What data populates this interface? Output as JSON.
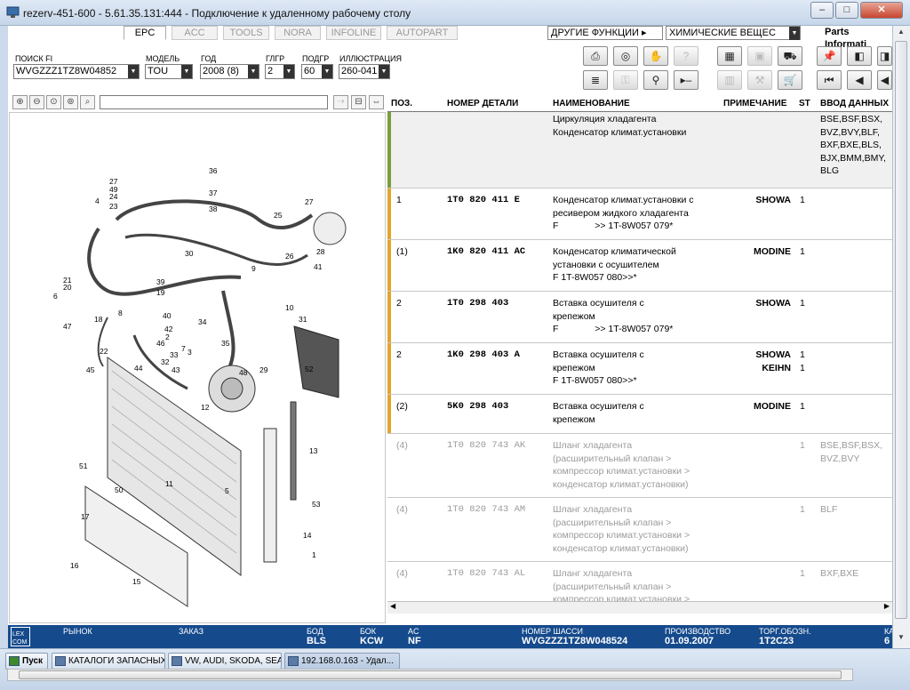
{
  "window": {
    "title": "rezerv-451-600 - 5.61.35.131:444 - Подключение к удаленному рабочему столу"
  },
  "tabs": [
    {
      "label": "EPC",
      "active": true
    },
    {
      "label": "ACC"
    },
    {
      "label": "TOOLS"
    },
    {
      "label": "NORA"
    },
    {
      "label": "INFOLINE"
    },
    {
      "label": "AUTOPART"
    }
  ],
  "top_menus": {
    "other_functions": "ДРУГИЕ ФУНКЦИИ",
    "chemicals": "ХИМИЧЕСКИЕ ВЕЩЕС",
    "parts_info": "Parts Informati"
  },
  "filters": {
    "vin": {
      "label": "ПОИСК FI",
      "value": "WVGZZZ1TZ8W04852"
    },
    "model": {
      "label": "МОДЕЛЬ",
      "value": "TOU"
    },
    "year": {
      "label": "ГОД",
      "value": "2008 (8)"
    },
    "group": {
      "label": "ГЛГР",
      "value": "2"
    },
    "subgroup": {
      "label": "ПОДГР",
      "value": "60"
    },
    "illustration": {
      "label": "ИЛЛЮСТРАЦИЯ",
      "value": "260-041"
    }
  },
  "table": {
    "headers": {
      "pos": "ПОЗ.",
      "part_no": "НОМЕР ДЕТАЛИ",
      "name": "НАИМЕНОВАНИЕ",
      "note": "ПРИМЕЧАНИЕ",
      "qty": "ST",
      "input": "ВВОД ДАННЫХ"
    },
    "header_row": {
      "name": "Циркуляция хладагента\nКонденсатор климат.установки",
      "input": "BSE,BSF,BSX,\nBVZ,BVY,BLF,\nBXF,BXE,BLS,\nBJX,BMM,BMY,\nBLG"
    },
    "rows": [
      {
        "pos": "1",
        "part": "1T0 820 411 E",
        "name": "Конденсатор климат.установки с\nресивером жидкого хладагента\nF              >> 1T-8W057 079*",
        "note": "SHOWA",
        "qty": "1",
        "input": ""
      },
      {
        "pos": "(1)",
        "part": "1K0 820 411 AC",
        "name": "Конденсатор климатической\nустановки с осушителем\nF 1T-8W057 080>>*",
        "note": "MODINE",
        "qty": "1",
        "input": ""
      },
      {
        "pos": "2",
        "part": "1T0 298 403",
        "name": "Вставка осушителя с\nкрепежом\nF              >> 1T-8W057 079*",
        "note": "SHOWA",
        "qty": "1",
        "input": ""
      },
      {
        "pos": "2",
        "part": "1K0 298 403 A",
        "name": "Вставка осушителя с\nкрепежом\nF 1T-8W057 080>>*",
        "note": "SHOWA\nKEIHN",
        "qty": "1\n1",
        "input": ""
      },
      {
        "pos": "(2)",
        "part": "5K0 298 403",
        "name": "Вставка осушителя с\nкрепежом",
        "note": "MODINE",
        "qty": "1",
        "input": ""
      },
      {
        "pos": "(4)",
        "part": "1T0 820 743 AK",
        "name": "Шланг хладагента\n(расширительный клапан >\nкомпрессор климат.установки >\nконденсатор климат.установки)",
        "note": "",
        "qty": "1",
        "input": "BSE,BSF,BSX,\nBVZ,BVY"
      },
      {
        "pos": "(4)",
        "part": "1T0 820 743 AM",
        "name": "Шланг хладагента\n(расширительный клапан >\nкомпрессор климат.установки >\nконденсатор климат.установки)",
        "note": "",
        "qty": "1",
        "input": "BLF"
      },
      {
        "pos": "(4)",
        "part": "1T0 820 743 AL",
        "name": "Шланг хладагента\n(расширительный клапан >\nкомпрессор климат.установки >",
        "note": "",
        "qty": "1",
        "input": "BXF,BXE"
      }
    ]
  },
  "status": {
    "market": {
      "label": "РЫНОК",
      "value": ""
    },
    "order": {
      "label": "ЗАКАЗ",
      "value": ""
    },
    "bod": {
      "label": "БОД",
      "value": "BLS"
    },
    "bok": {
      "label": "БОК",
      "value": "KCW"
    },
    "ac": {
      "label": "AC",
      "value": "NF"
    },
    "chassis": {
      "label": "НОМЕР ШАССИ",
      "value": "WVGZZZ1TZ8W048524"
    },
    "production": {
      "label": "ПРОИЗВОДСТВО",
      "value": "01.09.2007"
    },
    "trade": {
      "label": "ТОРГ.ОБОЗН.",
      "value": "1T2C23"
    },
    "extra": {
      "label": "КА",
      "value": "6"
    }
  },
  "diagram_labels": [
    "36",
    "37",
    "38",
    "27",
    "49",
    "24",
    "23",
    "4",
    "25",
    "26",
    "27",
    "28",
    "30",
    "9",
    "41",
    "21",
    "20",
    "6",
    "39",
    "19",
    "40",
    "18",
    "8",
    "42",
    "2",
    "7",
    "46",
    "34",
    "35",
    "10",
    "31",
    "47",
    "45",
    "16",
    "22",
    "32",
    "33",
    "44",
    "43",
    "48",
    "29",
    "52",
    "3",
    "12",
    "13",
    "17",
    "53",
    "5",
    "51",
    "50",
    "1",
    "14",
    "15",
    "11"
  ],
  "taskbar": {
    "start": "Пуск",
    "tasks": [
      "КАТАЛОГИ ЗАПАСНЫХ ...",
      "VW, AUDI, SKODA, SEAT",
      "192.168.0.163 - Удал..."
    ]
  },
  "colors": {
    "accent_orange": "#e3a52a",
    "status_blue": "#154a8c",
    "header_green": "#7a9e3c"
  }
}
